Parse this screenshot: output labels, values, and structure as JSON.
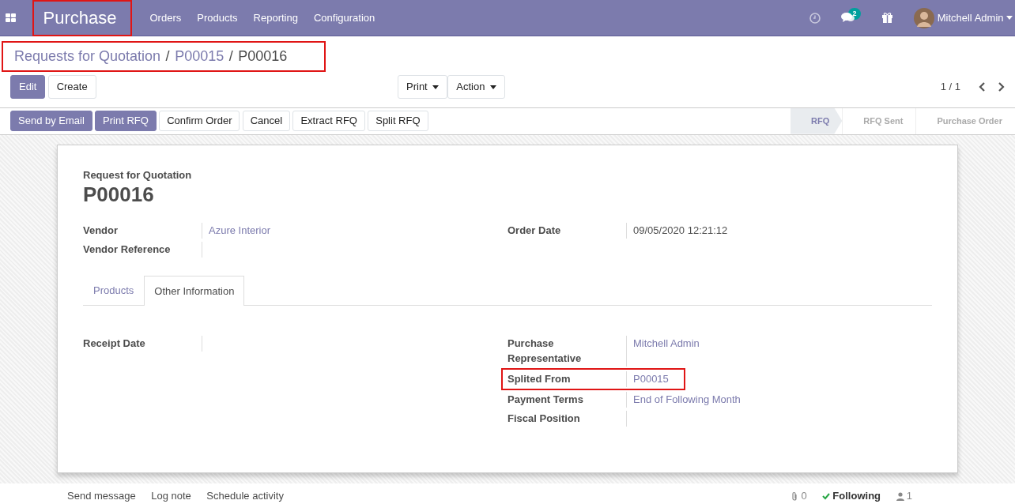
{
  "navbar": {
    "app_name": "Purchase",
    "app_highlighted": true,
    "menu": [
      "Orders",
      "Products",
      "Reporting",
      "Configuration"
    ],
    "message_count": "2",
    "user": "Mitchell Admin"
  },
  "breadcrumb": {
    "highlighted": true,
    "items": [
      {
        "label": "Requests for Quotation",
        "selected": false
      },
      {
        "separator": "/",
        "label": "P00015",
        "selected": false
      },
      {
        "separator": "/",
        "label": "P00016",
        "selected": true
      }
    ]
  },
  "control_buttons": [
    {
      "label": "Edit",
      "kind": "primary"
    },
    {
      "label": "Create",
      "kind": "secondary"
    }
  ],
  "dropdowns": [
    "Print",
    "Action"
  ],
  "pager": "1 / 1",
  "header_buttons": [
    {
      "label": "Send by Email",
      "kind": "primary"
    },
    {
      "label": "Print RFQ",
      "kind": "primary"
    },
    {
      "label": "Confirm Order",
      "kind": "secondary"
    },
    {
      "label": "Cancel",
      "kind": "secondary"
    },
    {
      "label": "Extract RFQ",
      "kind": "secondary"
    },
    {
      "label": "Split RFQ",
      "kind": "secondary"
    }
  ],
  "status_steps": [
    {
      "label": "RFQ",
      "selected": true
    },
    {
      "label": "RFQ Sent",
      "selected": false
    },
    {
      "label": "Purchase Order",
      "selected": false
    }
  ],
  "form": {
    "subtitle": "Request for Quotation",
    "name": "P00016",
    "left_fields": [
      {
        "label": "Vendor",
        "value": "Azure Interior",
        "kind": "link"
      },
      {
        "label": "Vendor Reference"
      }
    ],
    "right_fields": [
      {
        "label": "Order Date",
        "value": "09/05/2020 12:21:12",
        "kind": "text"
      }
    ],
    "tabs": [
      {
        "label": "Products",
        "selected": false
      },
      {
        "label": "Other Information",
        "selected": true
      }
    ],
    "tab_left_fields": [
      {
        "label": "Receipt Date",
        "highlighted": false
      }
    ],
    "tab_right_fields": [
      {
        "label": "Purchase Representative",
        "value": "Mitchell Admin",
        "kind": "link",
        "highlighted": false
      },
      {
        "label": "Splited From",
        "value": "P00015",
        "kind": "link",
        "highlighted": true
      },
      {
        "label": "Payment Terms",
        "value": "End of Following Month",
        "kind": "link",
        "highlighted": false
      },
      {
        "label": "Fiscal Position",
        "highlighted": false
      }
    ]
  },
  "chatter": {
    "actions": [
      "Send message",
      "Log note",
      "Schedule activity"
    ],
    "attachments": "0",
    "follow": "Following",
    "followers": "1"
  }
}
